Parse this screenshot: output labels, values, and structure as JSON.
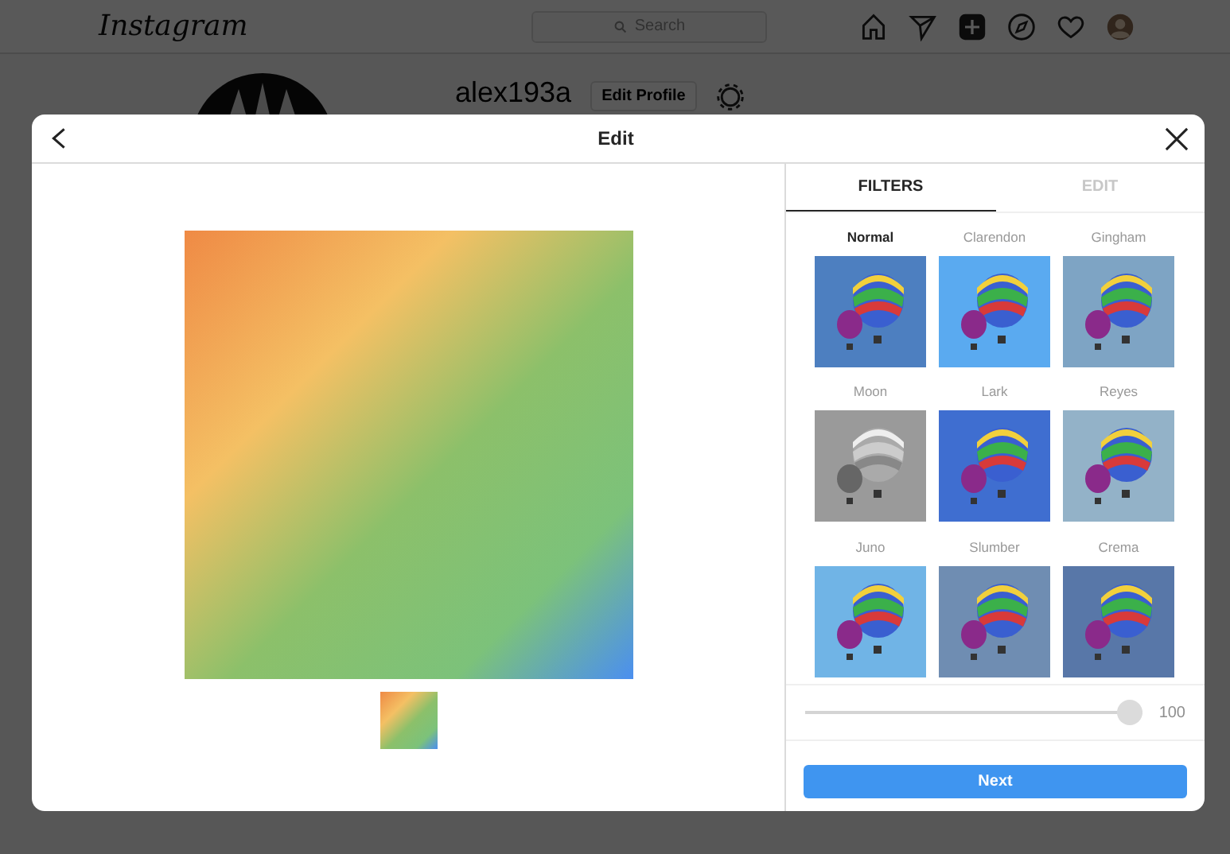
{
  "nav": {
    "logo": "Instagram",
    "search": {
      "placeholder": "Search"
    }
  },
  "profile": {
    "username": "alex193a",
    "edit_button": "Edit Profile"
  },
  "modal": {
    "title": "Edit",
    "tabs": [
      {
        "label": "FILTERS",
        "selected": true
      },
      {
        "label": "EDIT",
        "selected": false
      }
    ],
    "filters": [
      {
        "name": "Normal",
        "selected": true
      },
      {
        "name": "Clarendon",
        "selected": false
      },
      {
        "name": "Gingham",
        "selected": false
      },
      {
        "name": "Moon",
        "selected": false
      },
      {
        "name": "Lark",
        "selected": false
      },
      {
        "name": "Reyes",
        "selected": false
      },
      {
        "name": "Juno",
        "selected": false
      },
      {
        "name": "Slumber",
        "selected": false
      },
      {
        "name": "Crema",
        "selected": false
      }
    ],
    "strength": {
      "level": 1,
      "reading": "100"
    },
    "next_button": "Next"
  }
}
